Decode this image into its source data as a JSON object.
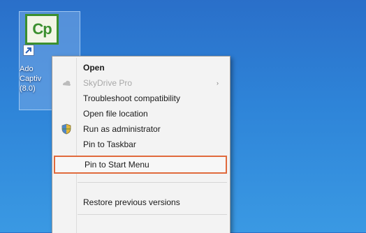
{
  "desktop": {
    "shortcut": {
      "logo_text": "Cp",
      "label_lines": [
        "Ado",
        "Captiv",
        "(8.0)"
      ]
    }
  },
  "context_menu": {
    "items": [
      {
        "label": "Open",
        "bold": true
      },
      {
        "label": "SkyDrive Pro",
        "disabled": true,
        "has_submenu": true,
        "icon": "skydrive-icon"
      },
      {
        "label": "Troubleshoot compatibility"
      },
      {
        "label": "Open file location"
      },
      {
        "label": "Run as administrator",
        "icon": "shield-icon"
      },
      {
        "label": "Pin to Taskbar"
      },
      {
        "label": "Pin to Start Menu",
        "highlighted": true
      },
      {
        "label": "Restore previous versions"
      }
    ],
    "submenu_arrow": "›"
  },
  "colors": {
    "highlight_border": "#e06a3c",
    "captivate_green": "#3b8f2e"
  }
}
